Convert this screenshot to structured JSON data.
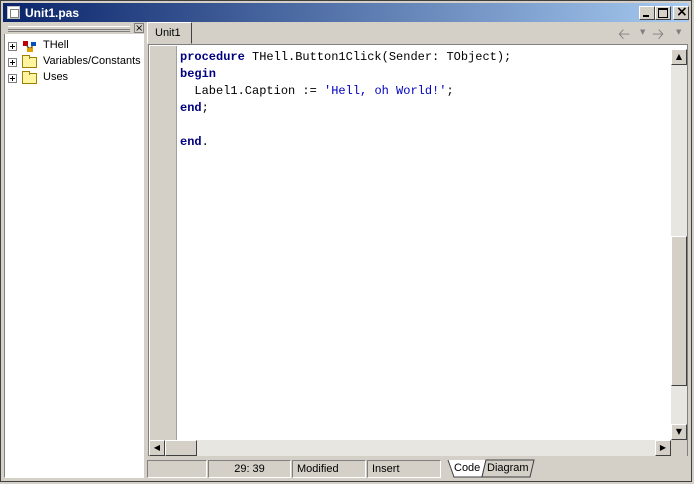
{
  "window": {
    "title": "Unit1.pas"
  },
  "left_panel": {
    "tree": [
      {
        "label": "THell",
        "icon": "class-icon"
      },
      {
        "label": "Variables/Constants",
        "icon": "folder-icon"
      },
      {
        "label": "Uses",
        "icon": "folder-icon"
      }
    ]
  },
  "tabs": [
    {
      "label": "Unit1"
    }
  ],
  "editor": {
    "lines": [
      [
        {
          "t": "procedure",
          "k": "kw"
        },
        {
          "t": " THell.Button1Click(Sender: TObject);",
          "k": ""
        }
      ],
      [
        {
          "t": "begin",
          "k": "kw"
        }
      ],
      [
        {
          "t": "  Label1.Caption := ",
          "k": ""
        },
        {
          "t": "'Hell, oh World!'",
          "k": "str"
        },
        {
          "t": ";",
          "k": ""
        }
      ],
      [
        {
          "t": "end",
          "k": "kw"
        },
        {
          "t": ";",
          "k": ""
        }
      ],
      [],
      [
        {
          "t": "end",
          "k": "kw"
        },
        {
          "t": ".",
          "k": ""
        }
      ]
    ]
  },
  "status": {
    "position": "29: 39",
    "modified": "Modified",
    "mode": "Insert"
  },
  "bottom_tabs": {
    "code": "Code",
    "diagram": "Diagram"
  }
}
